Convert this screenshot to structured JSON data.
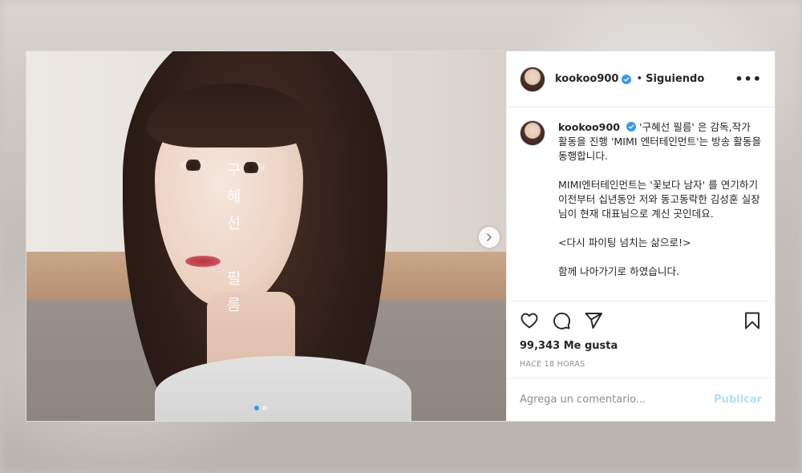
{
  "photo": {
    "overlay_title": "구혜선 필름",
    "next_icon": "chevron-right-icon",
    "carousel_dots": 2,
    "active_dot": 0
  },
  "header": {
    "username": "kookoo900",
    "separator": "•",
    "follow_status": "Siguiendo",
    "more_icon": "more-horizontal-icon",
    "more_label": "•••"
  },
  "caption": {
    "username": "kookoo900",
    "paragraphs": [
      "'구혜선 필름' 은 감독,작가 활동을 진행 'MIMI 엔터테인먼트'는 방송 활동을 동행합니다.",
      "MIMI엔터테인먼트는 '꽃보다 남자' 를 연기하기 이전부터 십년동안 저와 동고동락한 김성훈 실장님이 현재 대표님으로 계신 곳인데요.",
      "<다시 파이팅 넘치는 삶으로!>",
      "함께 나아가기로 하였습니다."
    ]
  },
  "actions": {
    "like_icon": "heart-icon",
    "comment_icon": "comment-icon",
    "share_icon": "share-icon",
    "save_icon": "bookmark-icon"
  },
  "likes": "99,343 Me gusta",
  "timestamp": "HACE 18 HORAS",
  "comment_box": {
    "placeholder": "Agrega un comentario...",
    "publish_label": "Publicar"
  },
  "colors": {
    "verified": "#3897f0",
    "publish_disabled": "#b2dffc",
    "text": "#262626",
    "muted": "#8e8e8e"
  }
}
